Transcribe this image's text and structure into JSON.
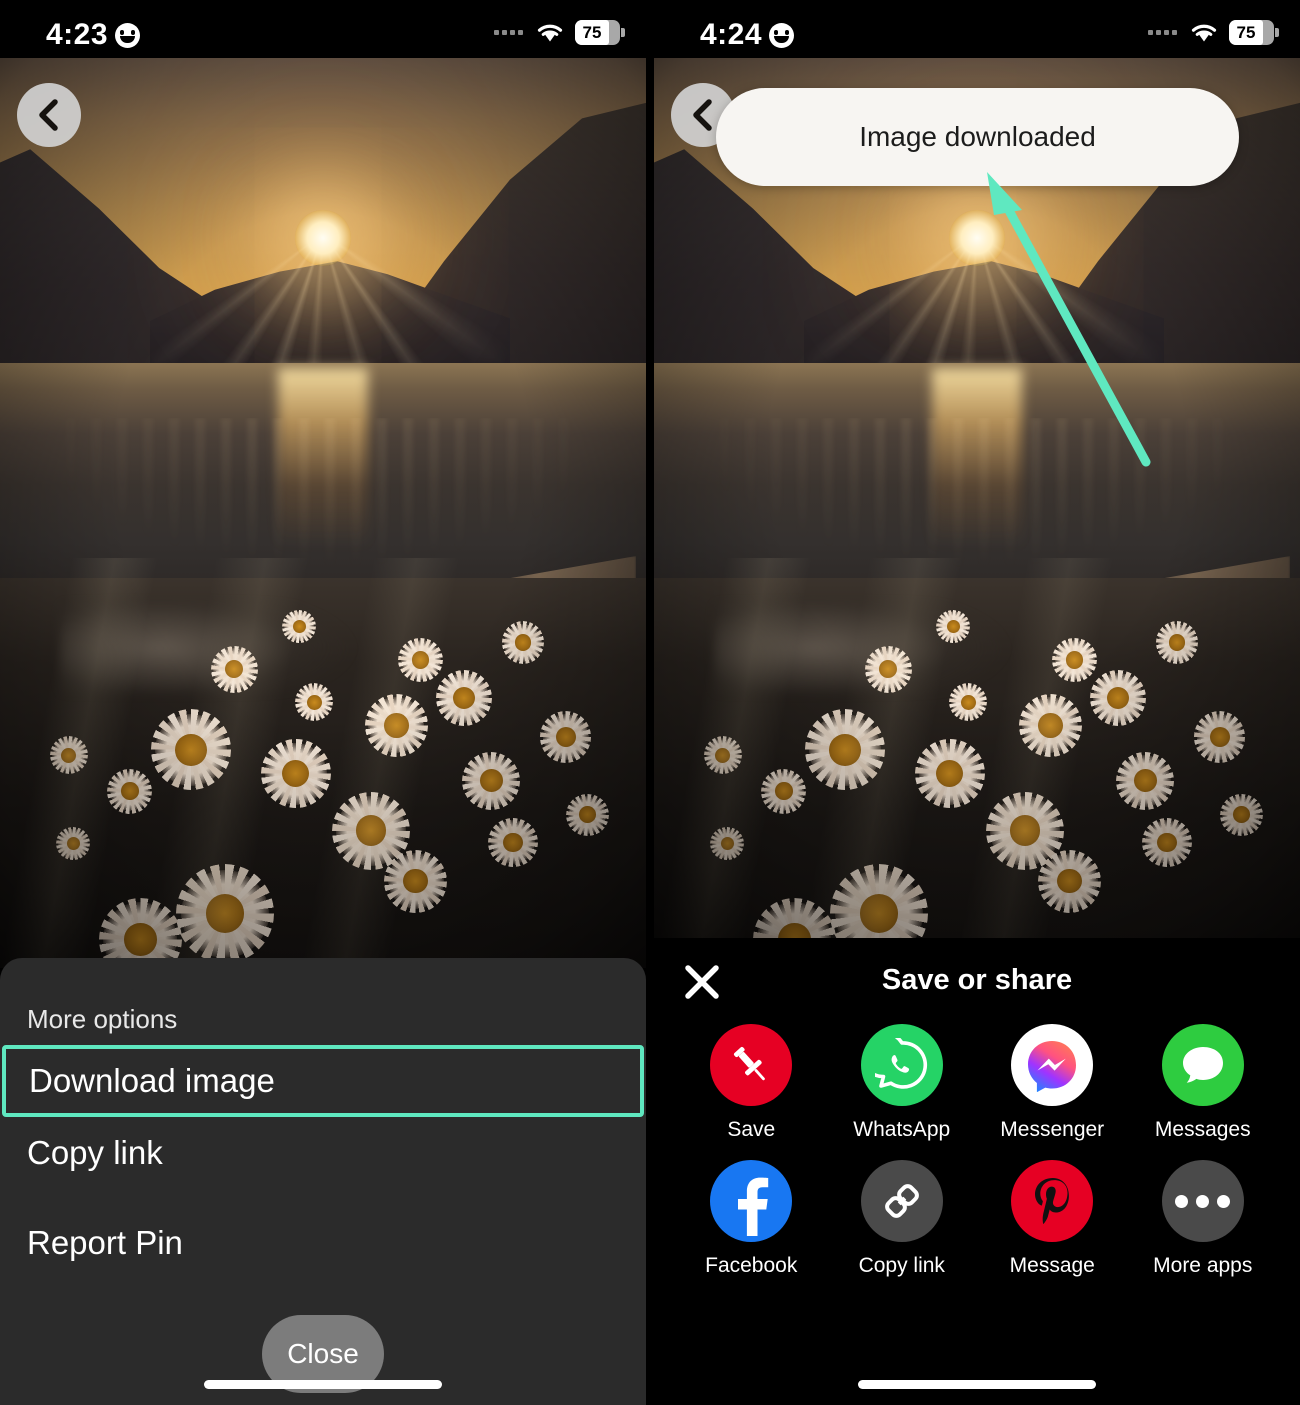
{
  "left_screen": {
    "status_bar": {
      "time": "4:23",
      "emoji_icon": "smiley-face-icon",
      "signal_dots": "••••",
      "wifi_icon": "wifi-icon",
      "battery_percent": "75"
    },
    "back_button_icon": "chevron-left-icon",
    "sheet": {
      "title": "More options",
      "options": [
        {
          "label": "Download image",
          "highlighted": true
        },
        {
          "label": "Copy link",
          "highlighted": false
        },
        {
          "label": "Report Pin",
          "highlighted": false
        }
      ],
      "close_label": "Close"
    }
  },
  "right_screen": {
    "status_bar": {
      "time": "4:24",
      "emoji_icon": "smiley-face-icon",
      "signal_dots": "••••",
      "wifi_icon": "wifi-icon",
      "battery_percent": "75"
    },
    "back_button_icon": "chevron-left-icon",
    "toast": {
      "message": "Image downloaded"
    },
    "share_sheet": {
      "close_icon": "close-x-icon",
      "title": "Save or share",
      "items": [
        {
          "label": "Save",
          "icon": "pinterest-pin-icon",
          "bg": "#e60023"
        },
        {
          "label": "WhatsApp",
          "icon": "whatsapp-icon",
          "bg": "#25D366"
        },
        {
          "label": "Messenger",
          "icon": "messenger-icon",
          "bg": "#ffffff"
        },
        {
          "label": "Messages",
          "icon": "messages-bubble-icon",
          "bg": "#2ecc40"
        },
        {
          "label": "Facebook",
          "icon": "facebook-icon",
          "bg": "#1877f2"
        },
        {
          "label": "Copy link",
          "icon": "chain-link-icon",
          "bg": "#4a4a4a"
        },
        {
          "label": "Message",
          "icon": "pinterest-p-icon",
          "bg": "#e60023"
        },
        {
          "label": "More apps",
          "icon": "ellipsis-icon",
          "bg": "#4a4a4a"
        }
      ]
    }
  },
  "annotations": {
    "highlight_color": "#5fe8c0",
    "arrow_color": "#5fe8c0",
    "arrow_target": "Image downloaded toast"
  }
}
